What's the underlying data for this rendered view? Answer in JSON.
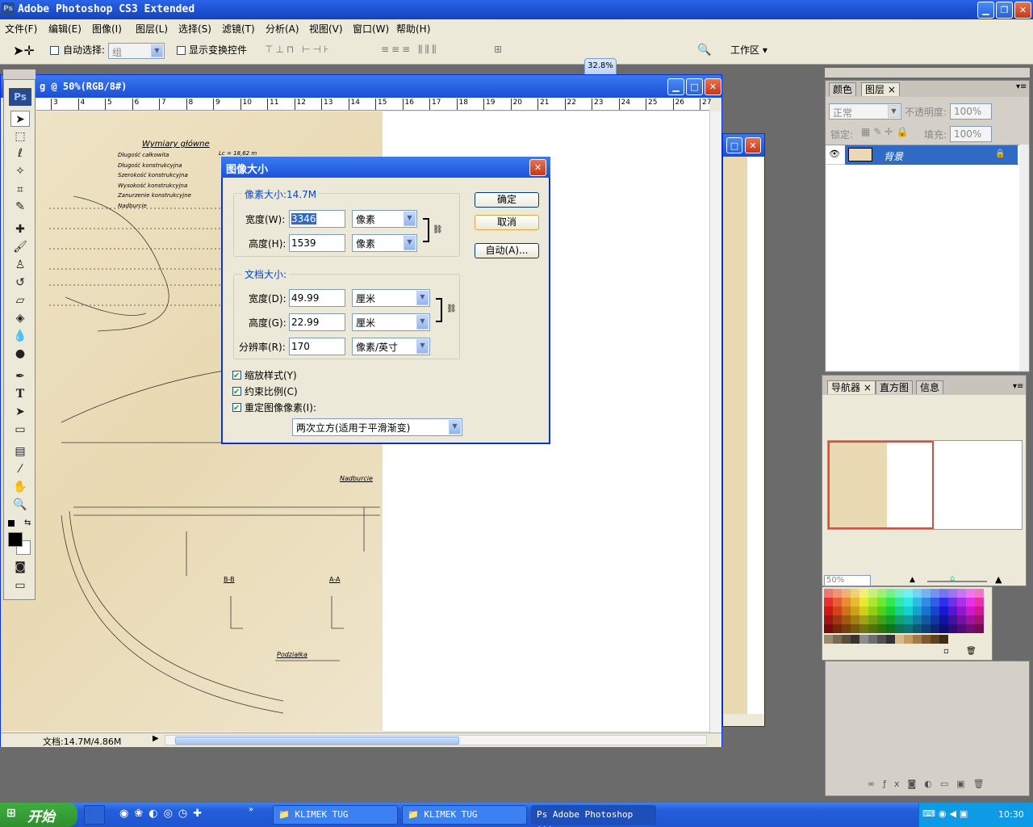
{
  "app": {
    "title": "Adobe Photoshop CS3 Extended"
  },
  "menu": [
    "文件(F)",
    "编辑(E)",
    "图像(I)",
    "图层(L)",
    "选择(S)",
    "滤镜(T)",
    "分析(A)",
    "视图(V)",
    "窗口(W)",
    "帮助(H)"
  ],
  "options": {
    "auto_select_label": "自动选择:",
    "auto_select_value": "组",
    "show_transform_label": "显示变换控件",
    "workspace_label": "工作区 ▾"
  },
  "zoom_badge": "32.8%",
  "document": {
    "title": "g @ 50%(RGB/8#)",
    "status": "文档:14.7M/4.86M",
    "ruler_ticks": [
      "3",
      "4",
      "5",
      "6",
      "7",
      "8",
      "9",
      "10",
      "11",
      "12",
      "13",
      "14",
      "15",
      "16",
      "17",
      "18",
      "19",
      "20",
      "21",
      "22",
      "23",
      "24",
      "25",
      "26",
      "27"
    ]
  },
  "drawing": {
    "heading": "Wymiary główne",
    "specs": [
      "Długość całkowita",
      "Długość konstrukcyjna",
      "Szerokość konstrukcyjna",
      "Wysokość konstrukcyjna",
      "Zanurzenie konstrukcyjne",
      "Nadburcie"
    ],
    "spec_value": "Lc = 18,62 m",
    "label_nadburcie": "Nadburcie",
    "label_bb": "B-B",
    "label_aa": "A-A",
    "label_podzialka": "Podziałka"
  },
  "dialog": {
    "title": "图像大小",
    "pixel_group": "像素大小:14.7M",
    "width_label": "宽度(W):",
    "width_value": "3346",
    "width_unit": "像素",
    "height_label": "高度(H):",
    "height_value": "1539",
    "height_unit": "像素",
    "doc_group": "文档大小:",
    "doc_width_label": "宽度(D):",
    "doc_width_value": "49.99",
    "doc_width_unit": "厘米",
    "doc_height_label": "高度(G):",
    "doc_height_value": "22.99",
    "doc_height_unit": "厘米",
    "resolution_label": "分辨率(R):",
    "resolution_value": "170",
    "resolution_unit": "像素/英寸",
    "scale_styles": "缩放样式(Y)",
    "constrain": "约束比例(C)",
    "resample": "重定图像像素(I):",
    "resample_method": "两次立方(适用于平滑渐变)",
    "ok": "确定",
    "cancel": "取消",
    "auto": "自动(A)..."
  },
  "layers_panel": {
    "tabs": [
      "颜色",
      "图层"
    ],
    "blend_mode": "正常",
    "opacity_label": "不透明度:",
    "opacity_value": "100%",
    "lock_label": "锁定:",
    "fill_label": "填充:",
    "fill_value": "100%",
    "layer_name": "背景"
  },
  "navigator_panel": {
    "tabs": [
      "导航器",
      "直方图",
      "信息"
    ],
    "zoom_value": "50%"
  },
  "taskbar": {
    "start": "开始",
    "buttons": [
      "KLIMEK TUG",
      "KLIMEK TUG",
      "Adobe Photoshop ..."
    ],
    "clock": "10:30"
  }
}
